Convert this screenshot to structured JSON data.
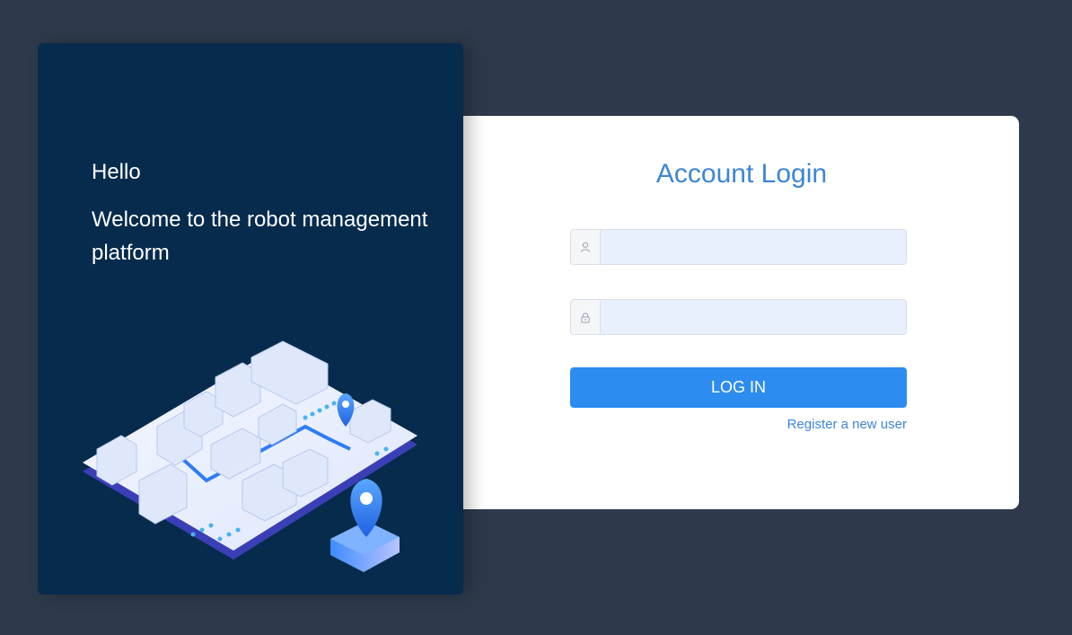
{
  "left": {
    "greeting": "Hello",
    "welcome": "Welcome to the robot management platform"
  },
  "login": {
    "title": "Account Login",
    "username": {
      "value": "",
      "placeholder": "",
      "icon": "user-icon"
    },
    "password": {
      "value": "",
      "placeholder": "",
      "icon": "lock-icon"
    },
    "button_label": "LOG IN",
    "register_link": "Register a new user"
  },
  "colors": {
    "background": "#2e3a4b",
    "left_panel": "#062b4d",
    "accent": "#2d8cf0",
    "title": "#3c86d6",
    "input_bg": "#e9f0fd"
  }
}
